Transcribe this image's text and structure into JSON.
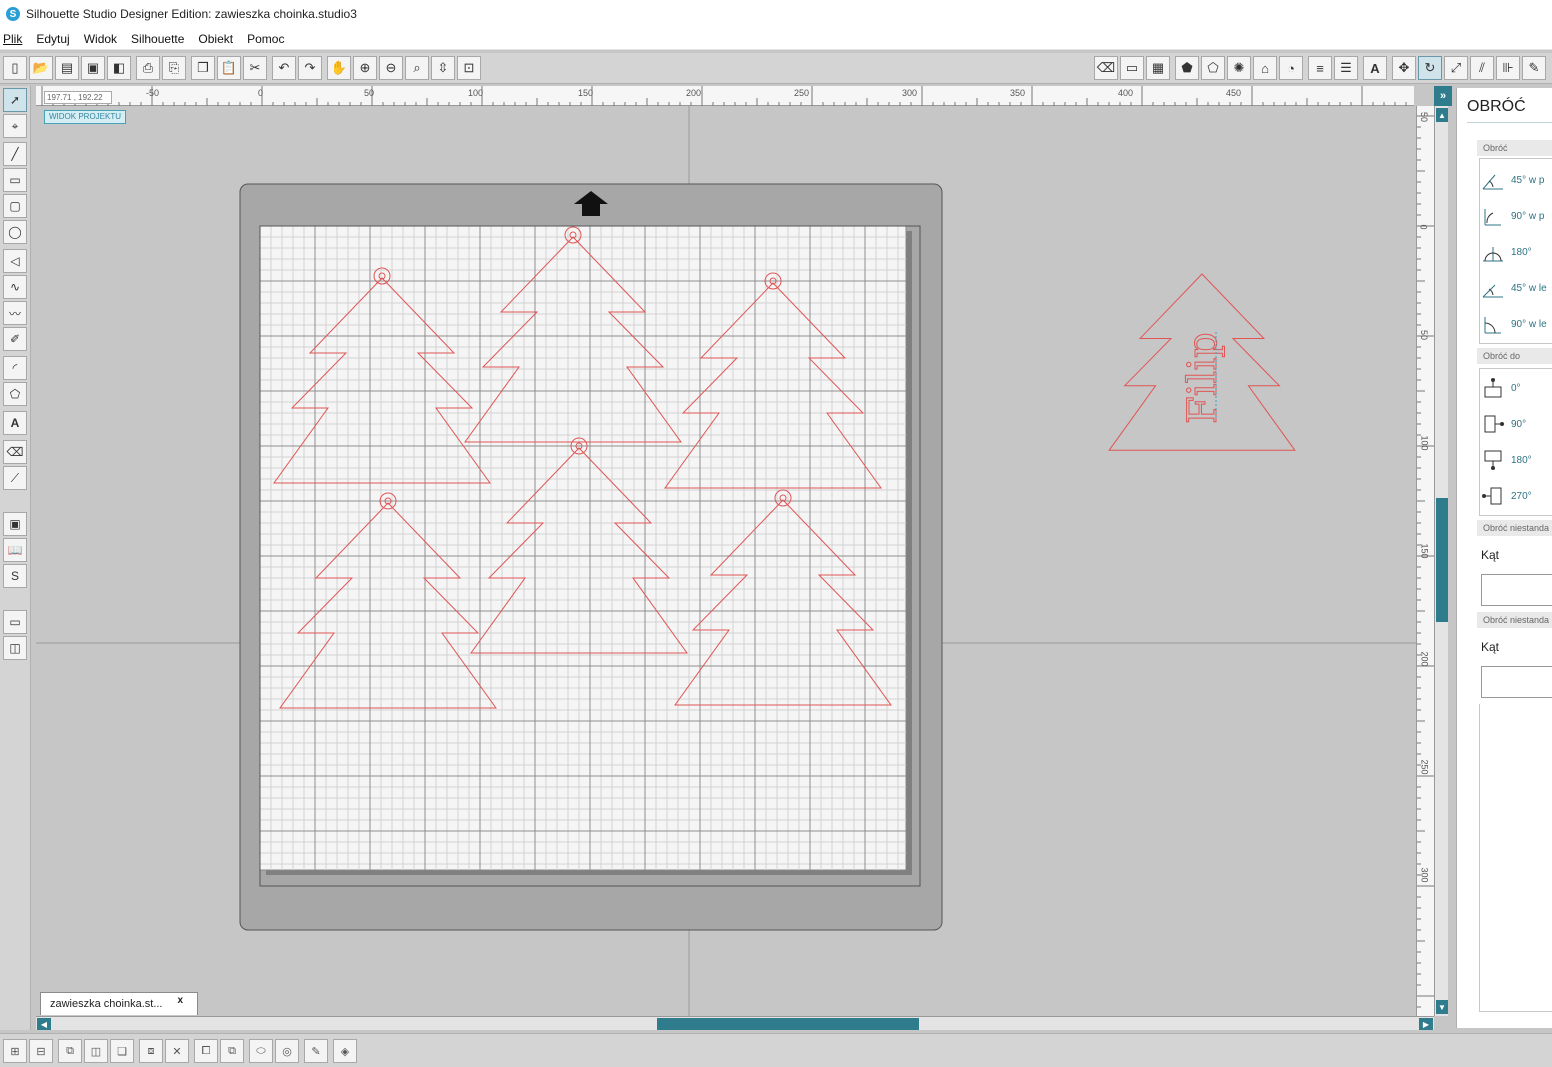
{
  "window": {
    "title": "Silhouette Studio Designer Edition: zawieszka choinka.studio3",
    "app_icon": "S"
  },
  "menu": {
    "items": [
      "Plik",
      "Edytuj",
      "Widok",
      "Silhouette",
      "Obiekt",
      "Pomoc"
    ]
  },
  "toolbar": {
    "left_icons": [
      "new-icon",
      "open-icon",
      "template-icon",
      "save-icon",
      "save-library-icon",
      "print-icon",
      "print-cut-icon",
      "copy-icon",
      "paste-icon",
      "cut-icon",
      "undo-icon",
      "redo-icon",
      "pan-icon",
      "zoom-in-icon",
      "zoom-out-icon",
      "zoom-select-icon",
      "drag-zoom-icon",
      "fit-page-icon"
    ],
    "right_icons": [
      "eraser-icon",
      "page-setup-icon",
      "grid-icon",
      "fill-color-icon",
      "gradient-icon",
      "fill-pattern-icon",
      "line-color-icon",
      "line-style-icon",
      "align-icon",
      "text-style-icon",
      "transform-icon",
      "rotate-icon",
      "scale-icon",
      "replicate-icon",
      "modify-icon",
      "offset-icon"
    ]
  },
  "left_tools": [
    "select-icon",
    "point-edit-icon",
    "line-icon",
    "rectangle-icon",
    "rounded-rect-icon",
    "ellipse-icon",
    "polygon-icon",
    "curve-icon",
    "freehand-icon",
    "smooth-freehand-icon",
    "arc-icon",
    "regular-polygon-icon",
    "text-icon",
    "eraser-icon",
    "knife-icon",
    "library-icon",
    "store-icon",
    "silhouette-icon",
    "send-panel-icon",
    "layout-icon"
  ],
  "ruler": {
    "coordinates": "197.71 , 192.22",
    "top_labels": [
      "-50",
      "0",
      "50",
      "100",
      "150",
      "200",
      "250",
      "300",
      "350",
      "400",
      "450"
    ],
    "left_labels": [
      "50",
      "0",
      "50",
      "100",
      "150",
      "200",
      "250",
      "300"
    ]
  },
  "view_badge": "WIDOK PROJEKTU",
  "design": {
    "tree_color": "#e05555",
    "text": "Filip"
  },
  "doc_tab": {
    "label": "zawieszka choinka.st...",
    "close": "x"
  },
  "panel": {
    "title": "OBRÓĆ",
    "rotate": {
      "header": "Obróć",
      "options": [
        "45° w p",
        "90° w p",
        "180°",
        "45° w le",
        "90° w le"
      ]
    },
    "rotate_to": {
      "header": "Obróć do",
      "options": [
        "0°",
        "90°",
        "180°",
        "270°"
      ]
    },
    "custom1": {
      "header": "Obróć niestanda",
      "label": "Kąt",
      "value": ""
    },
    "custom2": {
      "header": "Obróć niestanda",
      "label": "Kąt",
      "value": ""
    }
  },
  "bottom_tools": [
    "group-icon",
    "ungroup-icon",
    "compound-icon",
    "release-compound-icon",
    "bring-front-icon",
    "send-back-icon",
    "weld-icon",
    "subdivide-icon",
    "duplicate-icon",
    "mirror-icon",
    "trace-icon",
    "offset-icon",
    "sketch-icon",
    "cut-settings-icon"
  ]
}
